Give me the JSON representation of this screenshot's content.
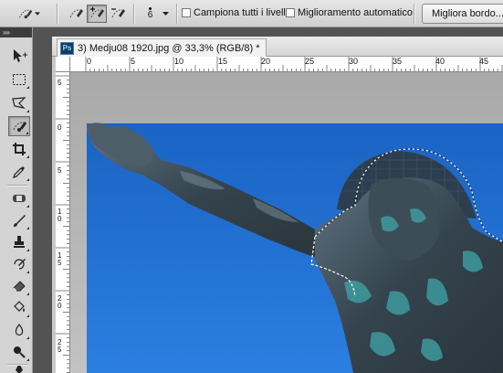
{
  "options_bar": {
    "brush_size": "6",
    "sample_all_layers": "Campiona tutti i livelli",
    "auto_enhance": "Miglioramento automatico",
    "refine_edge": "Migliora bordo..."
  },
  "toolbox": {
    "grip": "»»"
  },
  "document": {
    "tab_badge": "Ps",
    "tab_title": "3) Medju08 1920.jpg @ 33,3% (RGB/8) *"
  },
  "rulers": {
    "horizontal_ticks": [
      "0",
      "5",
      "10",
      "15",
      "20",
      "25",
      "30",
      "35",
      "40",
      "45"
    ],
    "vertical_ticks": [
      "5",
      "0",
      "5",
      "1 0",
      "1 5",
      "2 0",
      "2 5"
    ]
  },
  "colors": {
    "sky": "#1f6fd0",
    "statue": "#3a4a55",
    "patina": "#3fa6a8"
  }
}
